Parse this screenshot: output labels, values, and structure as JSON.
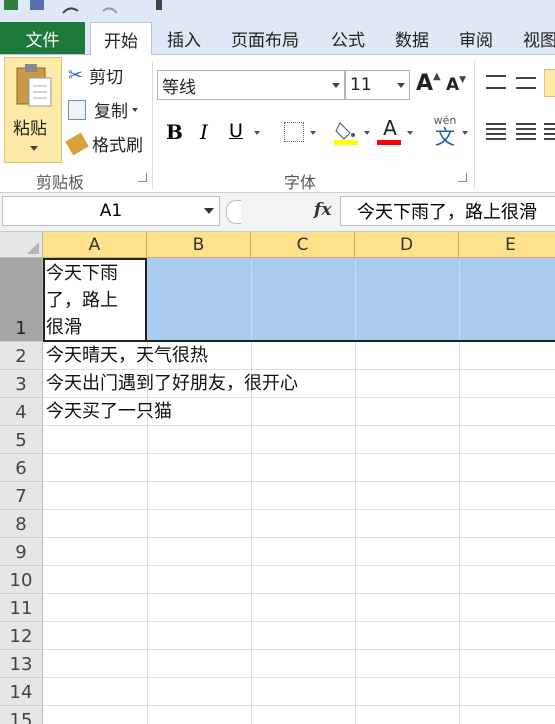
{
  "ribbon_tabs": {
    "file": "文件",
    "home": "开始",
    "insert": "插入",
    "page_layout": "页面布局",
    "formulas": "公式",
    "data": "数据",
    "review": "审阅",
    "view": "视图"
  },
  "clipboard": {
    "paste": "粘贴",
    "cut": "剪切",
    "copy": "复制",
    "format_painter": "格式刷",
    "group_label": "剪贴板"
  },
  "font": {
    "font_name": "等线",
    "font_size": "11",
    "bold": "B",
    "italic": "I",
    "underline": "U",
    "font_color_letter": "A",
    "phonetic": "wén",
    "phonetic_char": "文",
    "group_label": "字体",
    "grow_label": "A",
    "shrink_label": "A"
  },
  "formula_bar": {
    "name_box": "A1",
    "fx": "fx",
    "content": "今天下雨了，路上很滑"
  },
  "columns": [
    "A",
    "B",
    "C",
    "D",
    "E"
  ],
  "rows": [
    "1",
    "2",
    "3",
    "4",
    "5",
    "6",
    "7",
    "8",
    "9",
    "10",
    "11",
    "12",
    "13",
    "14",
    "15"
  ],
  "cells": {
    "A1_line1": "今天下雨",
    "A1_line2": "了，路上",
    "A1_line3": "很滑",
    "A2": "今天晴天，天气很热",
    "A3": "今天出门遇到了好朋友，很开心",
    "A4": "今天买了一只猫"
  },
  "colors": {
    "file_tab": "#1e7a3c",
    "selected_header": "#ffe18c",
    "selection_fill": "#a9cdef",
    "fill_color_bar": "#ffff00",
    "font_color_bar": "#ff0000"
  }
}
